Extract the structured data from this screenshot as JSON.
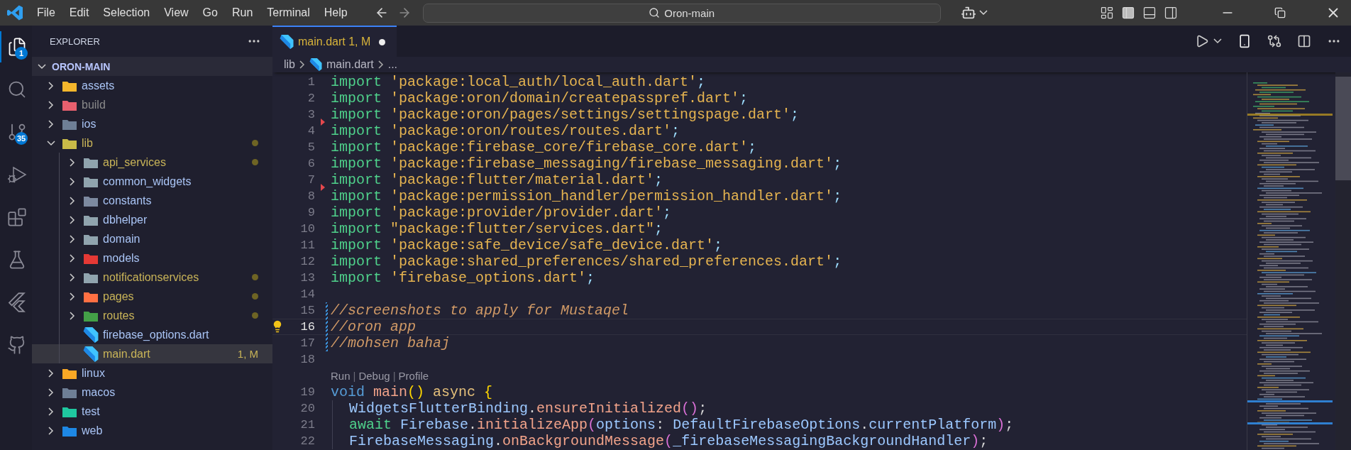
{
  "title_bar": {
    "menu": [
      "File",
      "Edit",
      "Selection",
      "View",
      "Go",
      "Run",
      "Terminal",
      "Help"
    ],
    "command_center": {
      "label": "Oron-main"
    },
    "layout_toggles": [
      {
        "kind": "customize",
        "on": false
      },
      {
        "kind": "primary-sidebar",
        "on": true
      },
      {
        "kind": "panel",
        "on": false
      },
      {
        "kind": "secondary-sidebar",
        "on": false
      }
    ]
  },
  "activity_bar": [
    {
      "kind": "explorer",
      "selected": true,
      "badge": "1"
    },
    {
      "kind": "search",
      "selected": false
    },
    {
      "kind": "source-control",
      "selected": false,
      "badge": "35"
    },
    {
      "kind": "run-debug",
      "selected": false
    },
    {
      "kind": "extensions",
      "selected": false
    },
    {
      "kind": "testing",
      "selected": false
    },
    {
      "kind": "flutter",
      "selected": false
    },
    {
      "kind": "github",
      "selected": false
    }
  ],
  "sidebar": {
    "title": "EXPLORER",
    "root": {
      "label": "ORON-MAIN",
      "expanded": true
    },
    "items": [
      {
        "label": "assets",
        "kind": "folder",
        "color": "#f5b72c",
        "modified": false,
        "ignored": false,
        "dot": false,
        "expanded": false,
        "selected": false
      },
      {
        "label": "build",
        "kind": "folder",
        "color": "#e8606e",
        "modified": false,
        "ignored": true,
        "dot": false,
        "expanded": false,
        "selected": false
      },
      {
        "label": "ios",
        "kind": "folder",
        "color": "#6e7f96",
        "modified": false,
        "ignored": false,
        "dot": false,
        "expanded": false,
        "selected": false
      },
      {
        "label": "lib",
        "kind": "folder",
        "color": "#c9bb48",
        "modified": true,
        "ignored": false,
        "dot": true,
        "expanded": true,
        "selected": false,
        "children": [
          {
            "label": "api_services",
            "kind": "folder",
            "color": "#90a4ae",
            "modified": true,
            "ignored": false,
            "dot": true,
            "expanded": false,
            "selected": false
          },
          {
            "label": "common_widgets",
            "kind": "folder",
            "color": "#90a4ae",
            "modified": false,
            "ignored": false,
            "dot": false,
            "expanded": false,
            "selected": false
          },
          {
            "label": "constants",
            "kind": "folder",
            "color": "#7d8aa0",
            "modified": false,
            "ignored": false,
            "dot": false,
            "expanded": false,
            "selected": false
          },
          {
            "label": "dbhelper",
            "kind": "folder",
            "color": "#90a4ae",
            "modified": false,
            "ignored": false,
            "dot": false,
            "expanded": false,
            "selected": false
          },
          {
            "label": "domain",
            "kind": "folder",
            "color": "#90a4ae",
            "modified": false,
            "ignored": false,
            "dot": false,
            "expanded": false,
            "selected": false
          },
          {
            "label": "models",
            "kind": "folder",
            "color": "#e53935",
            "modified": false,
            "ignored": false,
            "dot": false,
            "expanded": false,
            "selected": false
          },
          {
            "label": "notificationservices",
            "kind": "folder",
            "color": "#90a4ae",
            "modified": true,
            "ignored": false,
            "dot": true,
            "expanded": false,
            "selected": false
          },
          {
            "label": "pages",
            "kind": "folder",
            "color": "#ff7043",
            "modified": true,
            "ignored": false,
            "dot": true,
            "expanded": false,
            "selected": false
          },
          {
            "label": "routes",
            "kind": "folder",
            "color": "#43a047",
            "modified": true,
            "ignored": false,
            "dot": true,
            "expanded": false,
            "selected": false
          },
          {
            "label": "firebase_options.dart",
            "kind": "file",
            "modified": false,
            "ignored": false,
            "dot": false,
            "selected": false
          },
          {
            "label": "main.dart",
            "kind": "file",
            "modified": true,
            "ignored": false,
            "dot": false,
            "badge": "1, M",
            "selected": true
          }
        ]
      },
      {
        "label": "linux",
        "kind": "folder",
        "color": "#f9a825",
        "modified": false,
        "ignored": false,
        "dot": false,
        "expanded": false,
        "selected": false
      },
      {
        "label": "macos",
        "kind": "folder",
        "color": "#6e7f96",
        "modified": false,
        "ignored": false,
        "dot": false,
        "expanded": false,
        "selected": false
      },
      {
        "label": "test",
        "kind": "folder",
        "color": "#1fc8a0",
        "modified": false,
        "ignored": false,
        "dot": false,
        "expanded": false,
        "selected": false
      },
      {
        "label": "web",
        "kind": "folder",
        "color": "#1e88e5",
        "modified": false,
        "ignored": false,
        "dot": false,
        "expanded": false,
        "selected": false
      }
    ]
  },
  "editor": {
    "tabs": [
      {
        "label": "main.dart",
        "badge": "1, M",
        "dirty": true,
        "selected": true
      }
    ],
    "breadcrumbs": [
      {
        "label": "lib",
        "kind": "folder"
      },
      {
        "label": "main.dart",
        "kind": "dart"
      },
      {
        "label": "...",
        "kind": "more"
      }
    ],
    "lines": [
      {
        "kind": "code",
        "number": "1",
        "current": false,
        "error": false,
        "modified": false,
        "lightbulb": false,
        "indented": false,
        "tokens": [
          {
            "text": "import",
            "kind": "keyword"
          },
          {
            "text": " 'package:local_auth/local_auth.dart'",
            "kind": "string"
          },
          {
            "text": ";",
            "kind": "punct"
          }
        ]
      },
      {
        "kind": "code",
        "number": "2",
        "current": false,
        "error": false,
        "modified": false,
        "lightbulb": false,
        "indented": false,
        "tokens": [
          {
            "text": "import",
            "kind": "keyword"
          },
          {
            "text": " 'package:oron/domain/createpasspref.dart'",
            "kind": "string"
          },
          {
            "text": ";",
            "kind": "punct"
          }
        ]
      },
      {
        "kind": "code",
        "number": "3",
        "current": false,
        "error": false,
        "modified": false,
        "lightbulb": false,
        "indented": false,
        "tokens": [
          {
            "text": "import",
            "kind": "keyword"
          },
          {
            "text": " 'package:oron/pages/settings/settingspage.dart'",
            "kind": "string"
          },
          {
            "text": ";",
            "kind": "punct"
          }
        ]
      },
      {
        "kind": "code",
        "number": "4",
        "current": false,
        "error": true,
        "modified": false,
        "lightbulb": false,
        "indented": false,
        "tokens": [
          {
            "text": "import",
            "kind": "keyword"
          },
          {
            "text": " 'package:oron/routes/routes.dart'",
            "kind": "string"
          },
          {
            "text": ";",
            "kind": "punct"
          }
        ]
      },
      {
        "kind": "code",
        "number": "5",
        "current": false,
        "error": false,
        "modified": false,
        "lightbulb": false,
        "indented": false,
        "tokens": [
          {
            "text": "import",
            "kind": "keyword"
          },
          {
            "text": " 'package:firebase_core/firebase_core.dart'",
            "kind": "string"
          },
          {
            "text": ";",
            "kind": "punct"
          }
        ]
      },
      {
        "kind": "code",
        "number": "6",
        "current": false,
        "error": false,
        "modified": false,
        "lightbulb": false,
        "indented": false,
        "tokens": [
          {
            "text": "import",
            "kind": "keyword"
          },
          {
            "text": " 'package:firebase_messaging/firebase_messaging.dart'",
            "kind": "string"
          },
          {
            "text": ";",
            "kind": "punct"
          }
        ]
      },
      {
        "kind": "code",
        "number": "7",
        "current": false,
        "error": false,
        "modified": false,
        "lightbulb": false,
        "indented": false,
        "tokens": [
          {
            "text": "import",
            "kind": "keyword"
          },
          {
            "text": " 'package:flutter/material.dart'",
            "kind": "string"
          },
          {
            "text": ";",
            "kind": "punct"
          }
        ]
      },
      {
        "kind": "code",
        "number": "8",
        "current": false,
        "error": true,
        "modified": false,
        "lightbulb": false,
        "indented": false,
        "tokens": [
          {
            "text": "import",
            "kind": "keyword"
          },
          {
            "text": " 'package:permission_handler/permission_handler.dart'",
            "kind": "string"
          },
          {
            "text": ";",
            "kind": "punct"
          }
        ]
      },
      {
        "kind": "code",
        "number": "9",
        "current": false,
        "error": false,
        "modified": false,
        "lightbulb": false,
        "indented": false,
        "tokens": [
          {
            "text": "import",
            "kind": "keyword"
          },
          {
            "text": " 'package:provider/provider.dart'",
            "kind": "string"
          },
          {
            "text": ";",
            "kind": "punct"
          }
        ]
      },
      {
        "kind": "code",
        "number": "10",
        "current": false,
        "error": false,
        "modified": false,
        "lightbulb": false,
        "indented": false,
        "tokens": [
          {
            "text": "import",
            "kind": "keyword"
          },
          {
            "text": " \"package:flutter/services.dart\"",
            "kind": "string"
          },
          {
            "text": ";",
            "kind": "punct"
          }
        ]
      },
      {
        "kind": "code",
        "number": "11",
        "current": false,
        "error": false,
        "modified": false,
        "lightbulb": false,
        "indented": false,
        "tokens": [
          {
            "text": "import",
            "kind": "keyword"
          },
          {
            "text": " 'package:safe_device/safe_device.dart'",
            "kind": "string"
          },
          {
            "text": ";",
            "kind": "punct"
          }
        ]
      },
      {
        "kind": "code",
        "number": "12",
        "current": false,
        "error": false,
        "modified": false,
        "lightbulb": false,
        "indented": false,
        "tokens": [
          {
            "text": "import",
            "kind": "keyword"
          },
          {
            "text": " 'package:shared_preferences/shared_preferences.dart'",
            "kind": "string"
          },
          {
            "text": ";",
            "kind": "punct"
          }
        ]
      },
      {
        "kind": "code",
        "number": "13",
        "current": false,
        "error": false,
        "modified": false,
        "lightbulb": false,
        "indented": false,
        "tokens": [
          {
            "text": "import",
            "kind": "keyword"
          },
          {
            "text": " 'firebase_options.dart'",
            "kind": "string"
          },
          {
            "text": ";",
            "kind": "punct"
          }
        ]
      },
      {
        "kind": "code",
        "number": "14",
        "current": false,
        "error": false,
        "modified": false,
        "lightbulb": false,
        "indented": false
      },
      {
        "kind": "code",
        "number": "15",
        "current": false,
        "error": false,
        "modified": true,
        "lightbulb": false,
        "indented": false,
        "tokens": [
          {
            "text": "//screenshots to apply for Mustaqel",
            "kind": "comment"
          }
        ]
      },
      {
        "kind": "code",
        "number": "16",
        "current": true,
        "error": false,
        "modified": true,
        "lightbulb": true,
        "indented": false,
        "tokens": [
          {
            "text": "//oron app",
            "kind": "comment"
          }
        ]
      },
      {
        "kind": "code",
        "number": "17",
        "current": false,
        "error": false,
        "modified": true,
        "lightbulb": false,
        "indented": false,
        "tokens": [
          {
            "text": "//mohsen bahaj",
            "kind": "comment"
          }
        ]
      },
      {
        "kind": "code",
        "number": "18",
        "current": false,
        "error": false,
        "modified": false,
        "lightbulb": false,
        "indented": false
      },
      {
        "kind": "codelens",
        "items": [
          {
            "text": "Run",
            "kind": "link"
          },
          {
            "text": "|",
            "kind": "sep"
          },
          {
            "text": "Debug",
            "kind": "link"
          },
          {
            "text": "|",
            "kind": "sep"
          },
          {
            "text": "Profile",
            "kind": "link"
          }
        ]
      },
      {
        "kind": "code",
        "number": "19",
        "current": false,
        "error": false,
        "modified": false,
        "lightbulb": false,
        "indented": false,
        "tokens": [
          {
            "text": "void",
            "kind": "storage"
          },
          {
            "text": " main",
            "kind": "func"
          },
          {
            "text": "()",
            "kind": "bracket"
          },
          {
            "text": " async",
            "kind": "modifier"
          },
          {
            "text": " {",
            "kind": "bracket"
          }
        ]
      },
      {
        "kind": "code",
        "number": "20",
        "current": false,
        "error": false,
        "modified": false,
        "lightbulb": false,
        "indented": true,
        "tokens": [
          {
            "text": "WidgetsFlutterBinding",
            "kind": "type"
          },
          {
            "text": ".",
            "kind": "plain"
          },
          {
            "text": "ensureInitialized",
            "kind": "func"
          },
          {
            "text": "()",
            "kind": "bracket2"
          },
          {
            "text": ";",
            "kind": "plain"
          }
        ]
      },
      {
        "kind": "code",
        "number": "21",
        "current": false,
        "error": false,
        "modified": false,
        "lightbulb": false,
        "indented": true,
        "tokens": [
          {
            "text": "await",
            "kind": "keyword"
          },
          {
            "text": " Firebase",
            "kind": "type"
          },
          {
            "text": ".",
            "kind": "plain"
          },
          {
            "text": "initializeApp",
            "kind": "func"
          },
          {
            "text": "(",
            "kind": "bracket2"
          },
          {
            "text": "options",
            "kind": "type"
          },
          {
            "text": ": ",
            "kind": "plain"
          },
          {
            "text": "DefaultFirebaseOptions",
            "kind": "type"
          },
          {
            "text": ".",
            "kind": "plain"
          },
          {
            "text": "currentPlatform",
            "kind": "type"
          },
          {
            "text": ")",
            "kind": "bracket2"
          },
          {
            "text": ";",
            "kind": "plain"
          }
        ]
      },
      {
        "kind": "code",
        "number": "22",
        "current": false,
        "error": false,
        "modified": false,
        "lightbulb": false,
        "indented": true,
        "tokens": [
          {
            "text": "FirebaseMessaging",
            "kind": "type"
          },
          {
            "text": ".",
            "kind": "plain"
          },
          {
            "text": "onBackgroundMessage",
            "kind": "func"
          },
          {
            "text": "(",
            "kind": "bracket2"
          },
          {
            "text": "_firebaseMessagingBackgroundHandler",
            "kind": "type"
          },
          {
            "text": ")",
            "kind": "bracket2"
          },
          {
            "text": ";",
            "kind": "plain"
          }
        ]
      }
    ]
  }
}
